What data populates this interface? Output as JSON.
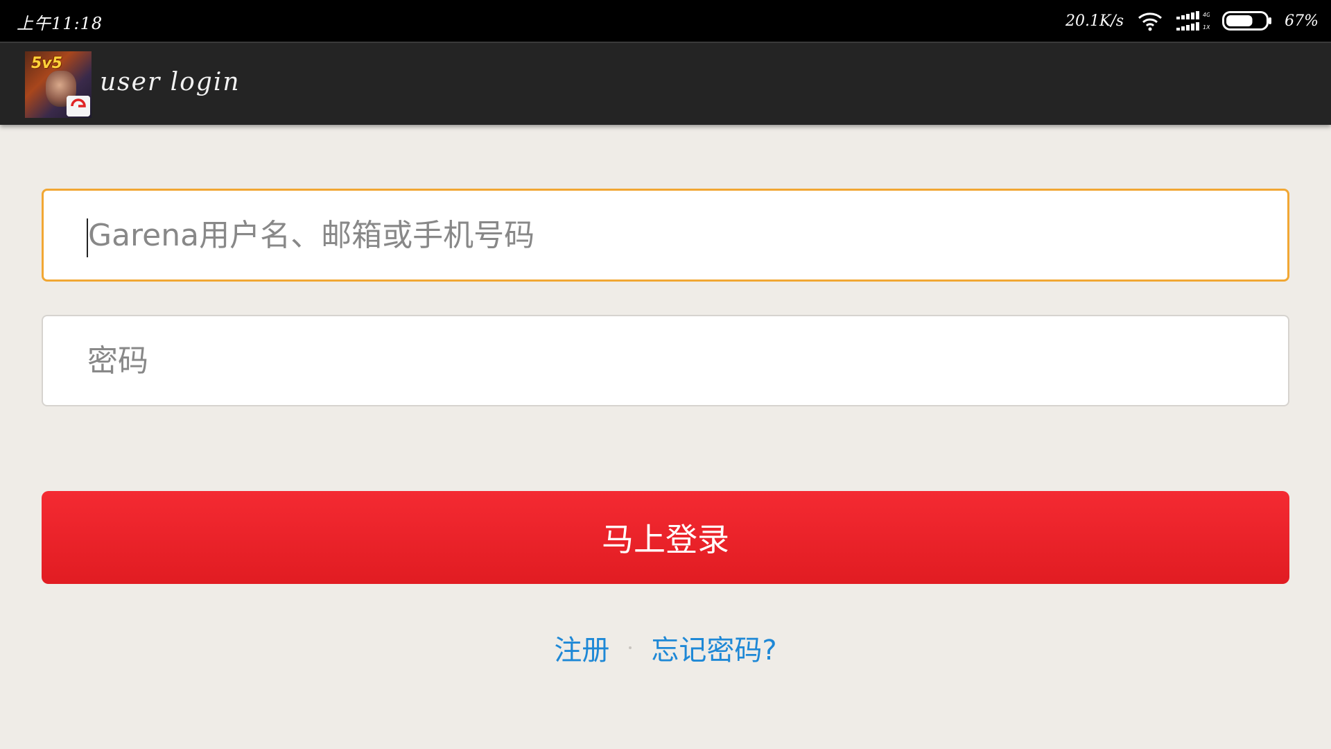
{
  "status_bar": {
    "time": "上午11:18",
    "net_speed": "20.1K/s",
    "battery_percent": "67%",
    "battery_level": 0.67,
    "icons": [
      "wifi-icon",
      "signal-icon",
      "battery-icon"
    ]
  },
  "app_bar": {
    "icon": "app-icon",
    "badge_text": "5v5",
    "title": "user login"
  },
  "form": {
    "username_placeholder": "Garena用户名、邮箱或手机号码",
    "username_value": "",
    "password_placeholder": "密码",
    "password_value": "",
    "login_button": "马上登录"
  },
  "links": {
    "register": "注册",
    "forgot_password": "忘记密码?"
  },
  "colors": {
    "accent_border": "#f1a733",
    "button_red": "#e81f26",
    "link_blue": "#1e88d6"
  }
}
